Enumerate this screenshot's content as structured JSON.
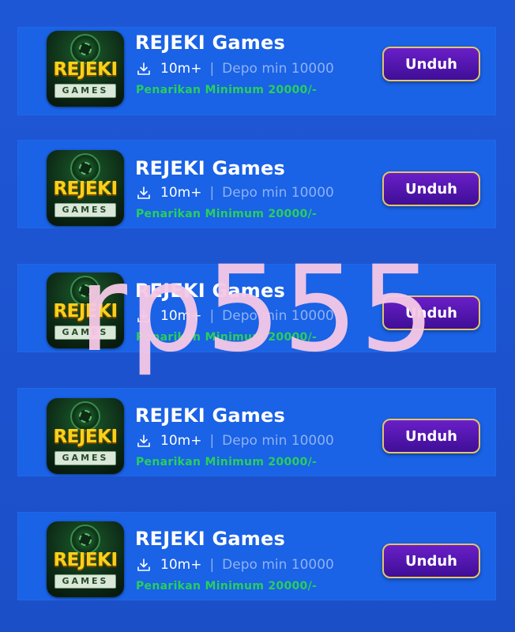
{
  "apps": [
    {
      "title": "REJEKI Games",
      "downloads": "10m+",
      "separator": "|",
      "deposit": "Depo min 10000",
      "withdrawal": "Penarikan Minimum 20000/-",
      "button_label": "Unduh",
      "icon": {
        "logo_top": "REJEKI",
        "logo_bottom": "GAMES"
      }
    },
    {
      "title": "REJEKI Games",
      "downloads": "10m+",
      "separator": "|",
      "deposit": "Depo min 10000",
      "withdrawal": "Penarikan Minimum 20000/-",
      "button_label": "Unduh",
      "icon": {
        "logo_top": "REJEKI",
        "logo_bottom": "GAMES"
      }
    },
    {
      "title": "REJEKI Games",
      "downloads": "10m+",
      "separator": "|",
      "deposit": "Depo min 10000",
      "withdrawal": "Penarikan Minimum 20000/-",
      "button_label": "Unduh",
      "icon": {
        "logo_top": "REJEKI",
        "logo_bottom": "GAMES"
      }
    },
    {
      "title": "REJEKI Games",
      "downloads": "10m+",
      "separator": "|",
      "deposit": "Depo min 10000",
      "withdrawal": "Penarikan Minimum 20000/-",
      "button_label": "Unduh",
      "icon": {
        "logo_top": "REJEKI",
        "logo_bottom": "GAMES"
      }
    },
    {
      "title": "REJEKI Games",
      "downloads": "10m+",
      "separator": "|",
      "deposit": "Depo min 10000",
      "withdrawal": "Penarikan Minimum 20000/-",
      "button_label": "Unduh",
      "icon": {
        "logo_top": "REJEKI",
        "logo_bottom": "GAMES"
      }
    }
  ],
  "overlay_text": "rp555",
  "colors": {
    "background": "#1e57d6",
    "card": "#1a62e6",
    "title": "#ffffff",
    "depo": "#8fb2f4",
    "withdrawal": "#27d05a",
    "button": "#4f14b0",
    "button_border": "#e5c46a",
    "overlay": "#f6c9e6",
    "logo_gold": "#f6d21a"
  },
  "icons": [
    "download-icon"
  ]
}
